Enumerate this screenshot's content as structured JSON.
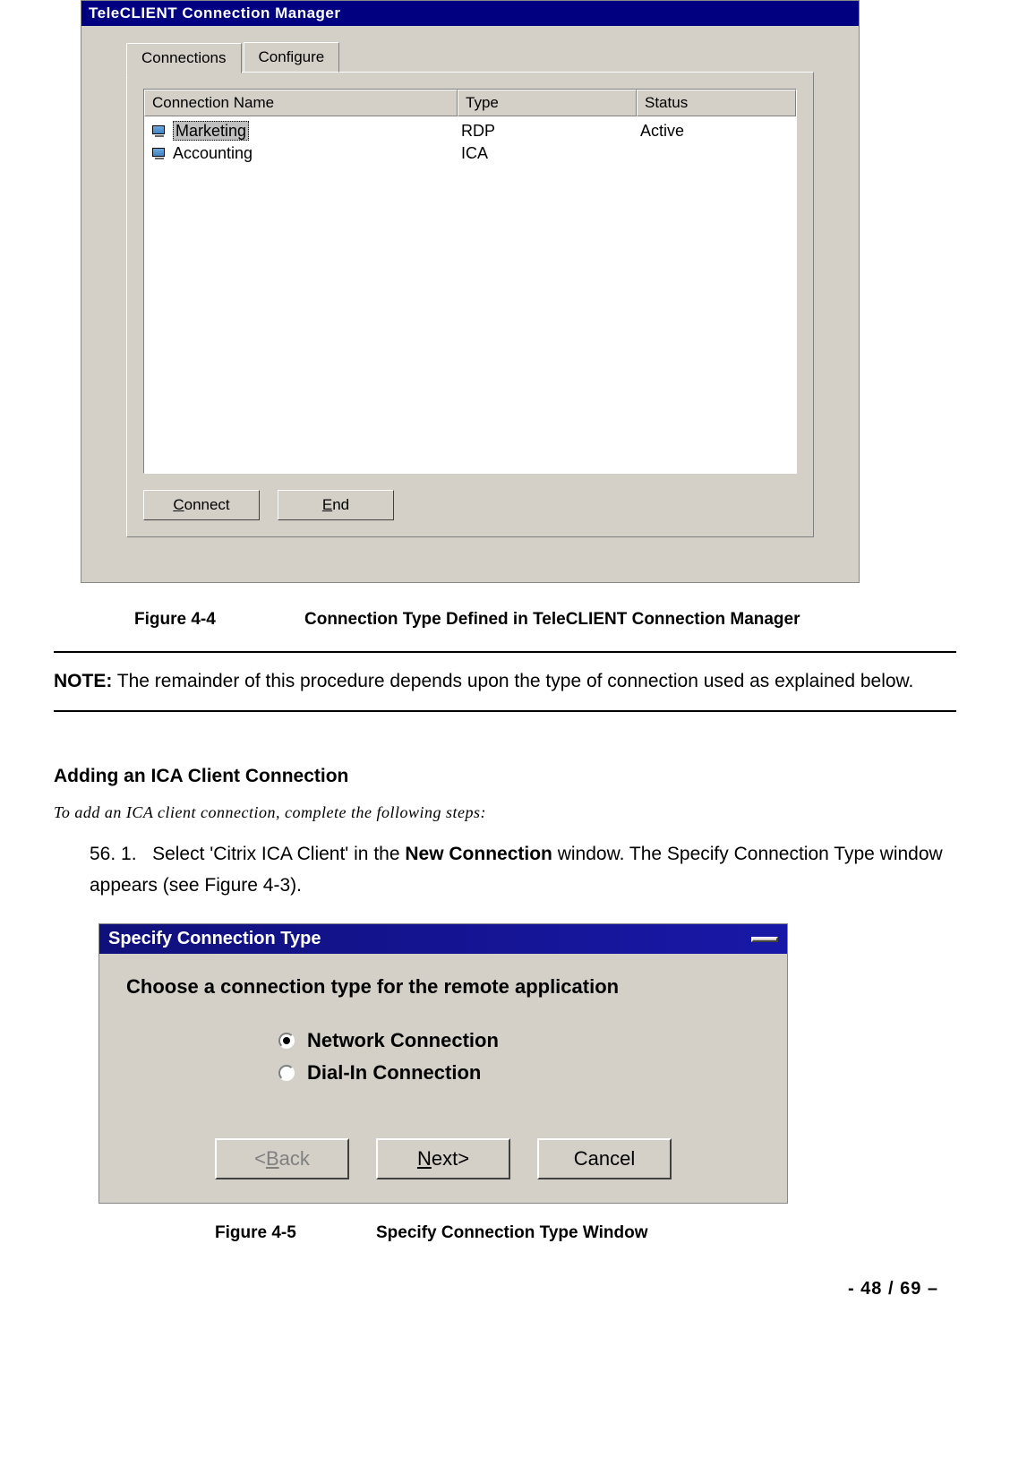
{
  "cm": {
    "title": "TeleCLIENT Connection Manager",
    "tabs": {
      "connections": "Connections",
      "configure": "Configure"
    },
    "headers": {
      "name": "Connection Name",
      "type": "Type",
      "status": "Status"
    },
    "rows": [
      {
        "name": "Marketing",
        "type": "RDP",
        "status": "Active",
        "selected": true
      },
      {
        "name": "Accounting",
        "type": "ICA",
        "status": "",
        "selected": false
      }
    ],
    "buttons": {
      "connect_pre": "C",
      "connect_rest": "onnect",
      "end_pre": "E",
      "end_rest": "nd"
    }
  },
  "fig44": {
    "num": "Figure 4-4",
    "caption": "Connection Type Defined in TeleCLIENT Connection Manager"
  },
  "note": {
    "label": "NOTE:",
    "text": " The remainder of this procedure depends upon the type of connection used as explained below."
  },
  "section": {
    "heading": "Adding an ICA Client Connection"
  },
  "intro_italic": "To add an ICA client connection, complete the following steps:",
  "step56": {
    "num": "56. 1.",
    "pre": "Select 'Citrix ICA Client' in the ",
    "bold": "New Connection",
    "post": " window. The Specify Connection Type window appears (see Figure 4-3)."
  },
  "sct": {
    "title": "Specify Connection Type",
    "heading": "Choose a connection type for the remote application",
    "options": {
      "network": "Network Connection",
      "dialin": "Dial-In Connection"
    },
    "buttons": {
      "back_lt": "<",
      "back_u": "B",
      "back_rest": "ack",
      "next_u": "N",
      "next_rest": "ext",
      "next_gt": ">",
      "cancel": "Cancel"
    }
  },
  "fig45": {
    "num": "Figure 4-5",
    "caption": "Specify Connection Type Window"
  },
  "pagenum": "- 48 / 69 –"
}
